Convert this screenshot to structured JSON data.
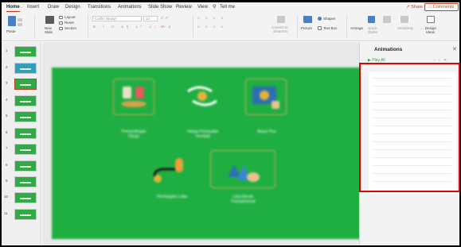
{
  "ribbon_tabs": [
    {
      "label": "Home",
      "active": true
    },
    {
      "label": "Insert"
    },
    {
      "label": "Draw"
    },
    {
      "label": "Design"
    },
    {
      "label": "Transitions"
    },
    {
      "label": "Animations"
    },
    {
      "label": "Slide Show"
    },
    {
      "label": "Review"
    },
    {
      "label": "View"
    },
    {
      "label": "Tell me"
    }
  ],
  "share_label": "Share",
  "comments_label": "Comments",
  "ribbon": {
    "paste": "Paste",
    "new_slide_line1": "New",
    "new_slide_line2": "Slide",
    "layout": "Layout",
    "reset": "Reset",
    "section": "Section",
    "font_name": "Calibri (Body)",
    "font_size": "12",
    "convert_line1": "Convert to",
    "convert_line2": "SmartArt",
    "picture": "Picture",
    "text_box": "Text Box",
    "shapes": "Shapes",
    "arrange": "Arrange",
    "quick_line1": "Quick",
    "quick_line2": "Styles",
    "sensitivity": "Sensitivity",
    "design_line1": "Design",
    "design_line2": "Ideas"
  },
  "slide_numbers": [
    "1",
    "2",
    "3",
    "4",
    "5",
    "6",
    "7",
    "8",
    "9",
    "10",
    "11"
  ],
  "slide_captions": {
    "c1_line1": "Perbandingan",
    "c1_line2": "Harga",
    "c2_line1": "Harga Persaudan",
    "c2_line2": "Kembali",
    "c3": "Biaya Plus",
    "c4": "Pembagian Laba",
    "c5_line1": "Laba Bersih",
    "c5_line2": "Transaksional"
  },
  "animations_pane": {
    "title": "Animations",
    "play_all": "Play All"
  },
  "colors": {
    "accent": "#c43e1c",
    "slide_green": "#1fae41",
    "highlight": "#e00000"
  }
}
